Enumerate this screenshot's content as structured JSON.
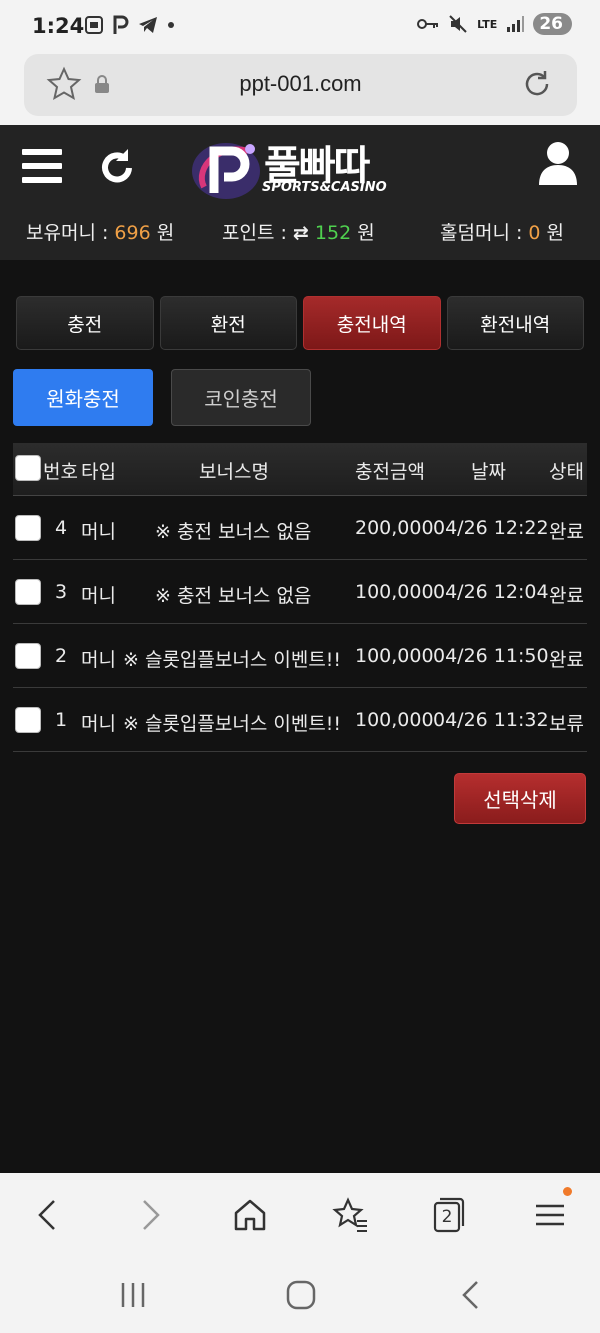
{
  "status_bar": {
    "time": "1:24",
    "left_icons": [
      "screenshot-icon",
      "p-app-icon",
      "telegram-icon",
      "dot-icon"
    ],
    "network": "LTE",
    "battery": "26"
  },
  "browser": {
    "url": "ppt-001.com",
    "tabs_count": "2"
  },
  "header": {
    "logo_text": "풀빠따",
    "logo_sub": "SPORTS&CASINO",
    "balances": {
      "money_label": "보유머니 : ",
      "money_value": "696",
      "point_label": "포인트 : ",
      "point_value": "152",
      "holdem_label": "홀덤머니 : ",
      "holdem_value": "0",
      "unit": "원"
    }
  },
  "tabs": [
    {
      "label": "충전",
      "active": false
    },
    {
      "label": "환전",
      "active": false
    },
    {
      "label": "충전내역",
      "active": true
    },
    {
      "label": "환전내역",
      "active": false
    }
  ],
  "subtabs": {
    "krw": "원화충전",
    "coin": "코인충전"
  },
  "table": {
    "headers": {
      "no": "번호",
      "type": "타입",
      "bonus": "보너스명",
      "amount": "충전금액",
      "date": "날짜",
      "status": "상태"
    },
    "rows": [
      {
        "no": "4",
        "type": "머니",
        "bonus": "※ 충전 보너스 없음",
        "amount": "200,000",
        "date": "04/26 12:22",
        "status": "완료"
      },
      {
        "no": "3",
        "type": "머니",
        "bonus": "※ 충전 보너스 없음",
        "amount": "100,000",
        "date": "04/26 12:04",
        "status": "완료"
      },
      {
        "no": "2",
        "type": "머니",
        "bonus": "※ 슬롯입플보너스 이벤트!!",
        "amount": "100,000",
        "date": "04/26 11:50",
        "status": "완료"
      },
      {
        "no": "1",
        "type": "머니",
        "bonus": "※ 슬롯입플보너스 이벤트!!",
        "amount": "100,000",
        "date": "04/26 11:32",
        "status": "보류"
      }
    ]
  },
  "actions": {
    "delete_selected": "선택삭제"
  },
  "colors": {
    "accent_red": "#a52a2a",
    "primary_blue": "#2f7cf0",
    "money_orange": "#f0a046",
    "point_green": "#4fd14f"
  }
}
